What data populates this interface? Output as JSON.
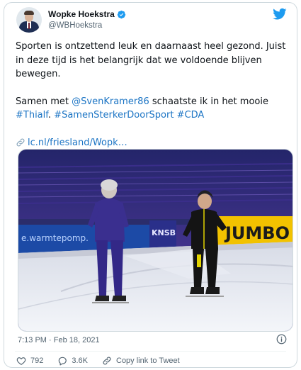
{
  "author": {
    "name": "Wopke Hoekstra",
    "handle": "@WBHoekstra",
    "verified": true
  },
  "tweet": {
    "line1": "Sporten is ontzettend leuk en daarnaast heel gezond. Juist",
    "line2": "in deze tijd is het belangrijk dat we voldoende blijven",
    "line3": "bewegen.",
    "line4_pre": "Samen met ",
    "mention": "@SvenKramer86",
    "line4_post": " schaatste ik in het mooie",
    "hashtag1": "#Thialf",
    "hashtag2": "#SamenSterkerDoorSport",
    "hashtag3": "#CDA",
    "link_text": "lc.nl/friesland/Wopk…"
  },
  "photo": {
    "banner_left": "e.warmtepomp.",
    "banner_right": "JUMBO",
    "banner_mid": "KNSB"
  },
  "meta": {
    "timestamp": "7:13 PM · Feb 18, 2021"
  },
  "actions": {
    "likes": "792",
    "replies": "3.6K",
    "copy_label": "Copy link to Tweet"
  },
  "colors": {
    "accent": "#1d9bf0",
    "text": "#0f1419",
    "secondary": "#536471",
    "link": "#1b74c4"
  },
  "icons": [
    "twitter-bird-icon",
    "verified-badge-icon",
    "link-icon",
    "info-icon",
    "heart-icon",
    "reply-icon",
    "copy-link-icon"
  ]
}
